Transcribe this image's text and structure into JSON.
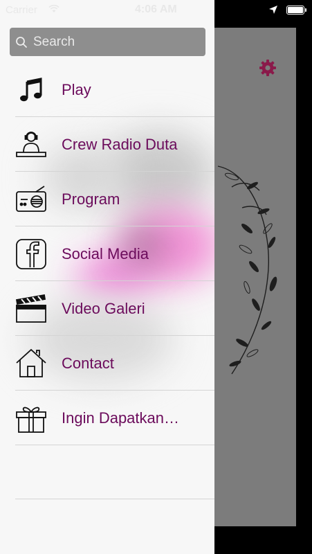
{
  "status_bar": {
    "carrier": "Carrier",
    "time": "4:06 AM",
    "wifi_icon": "wifi-icon",
    "location_icon": "location-arrow-icon",
    "battery_icon": "battery-icon"
  },
  "search": {
    "placeholder": "Search",
    "value": ""
  },
  "menu": {
    "items": [
      {
        "label": "Play",
        "icon": "music-note-icon"
      },
      {
        "label": "Crew Radio Duta",
        "icon": "dj-person-icon"
      },
      {
        "label": "Program",
        "icon": "radio-icon"
      },
      {
        "label": "Social Media",
        "icon": "facebook-icon"
      },
      {
        "label": "Video Galeri",
        "icon": "clapperboard-icon"
      },
      {
        "label": "Contact",
        "icon": "house-icon"
      },
      {
        "label": "Ingin Dapatkan…",
        "icon": "gift-icon"
      }
    ]
  },
  "main": {
    "settings_icon": "gear-icon"
  },
  "colors": {
    "accent": "#6b0b5b",
    "settings_icon": "#8a1a4a",
    "search_bg": "#8e8e8e",
    "drawer_bg": "#f7f7f7",
    "main_bg": "#7c7c7c"
  }
}
